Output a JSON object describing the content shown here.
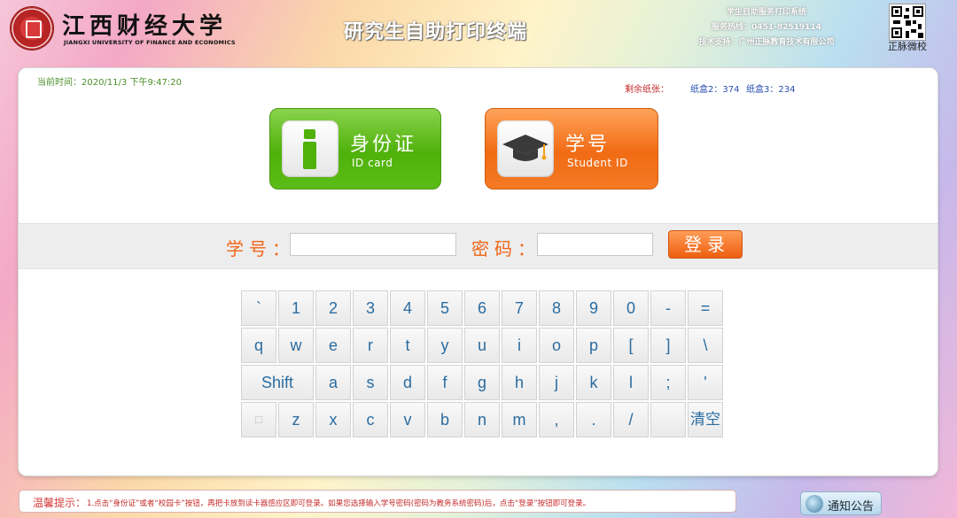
{
  "header": {
    "university_cn": "江西财经大学",
    "university_en": "JIANGXI UNIVERSITY OF FINANCE AND ECONOMICS",
    "title": "研究生自助打印终端",
    "info_lines": [
      "学生自助服务打印系统",
      "服务热线：0451-82519114",
      "技术支持：广州正脉教育技术有限公司"
    ],
    "qr_label": "正脉微校"
  },
  "status": {
    "time_label": "当前时间：2020/11/3 下午9:47:20",
    "paper_label": "剩余纸张：",
    "tray2": "纸盒2：374",
    "tray3": "纸盒3：234"
  },
  "login_options": {
    "id_card": {
      "cn": "身份证",
      "en": "ID card"
    },
    "student_id": {
      "cn": "学号",
      "en": "Student ID"
    }
  },
  "login_form": {
    "student_no_label": "学号：",
    "password_label": "密码：",
    "student_no_value": "",
    "password_value": "",
    "login_button": "登录"
  },
  "keyboard": {
    "rows": [
      [
        "`",
        "1",
        "2",
        "3",
        "4",
        "5",
        "6",
        "7",
        "8",
        "9",
        "0",
        "-",
        "="
      ],
      [
        "q",
        "w",
        "e",
        "r",
        "t",
        "y",
        "u",
        "i",
        "o",
        "p",
        "[",
        "]",
        "\\"
      ],
      [
        "Shift",
        "a",
        "s",
        "d",
        "f",
        "g",
        "h",
        "j",
        "k",
        "l",
        ";",
        "'"
      ],
      [
        "□",
        "z",
        "x",
        "c",
        "v",
        "b",
        "n",
        "m",
        ",",
        ".",
        "/",
        "",
        "清空"
      ]
    ]
  },
  "footer": {
    "tips_title": "温馨提示：",
    "tips_text": "1.点击“身份证”或者“校园卡”按钮，再把卡放到读卡器感应区即可登录。如果您选择输入学号密码(密码为教务系统密码)后，点击“登录”按钮即可登录。",
    "notice_button": "通知公告"
  },
  "colors": {
    "green": "#5cbc18",
    "orange": "#f16b14",
    "label_orange": "#f0661a",
    "key_text": "#2b6ca0"
  }
}
